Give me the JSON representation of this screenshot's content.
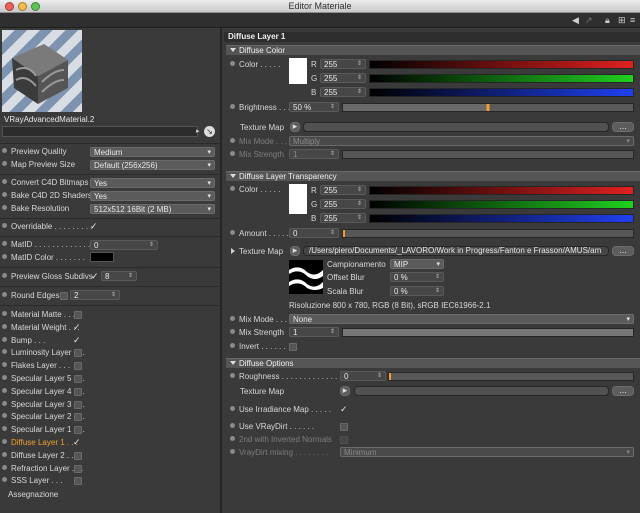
{
  "window": {
    "title": "Editor Materiale"
  },
  "material": {
    "name": "VRayAdvancedMaterial.2"
  },
  "left": {
    "preview_quality": {
      "label": "Preview Quality",
      "value": "Medium"
    },
    "map_preview_size": {
      "label": "Map Preview Size",
      "value": "Default (256x256)"
    },
    "convert_bitmaps": {
      "label": "Convert C4D Bitmaps",
      "value": "Yes"
    },
    "bake_shaders": {
      "label": "Bake C4D 2D Shaders",
      "value": "Yes"
    },
    "bake_resolution": {
      "label": "Bake Resolution",
      "value": "512x512  16Bit  (2 MB)"
    },
    "overridable": {
      "label": "Overridable",
      "check": "✓"
    },
    "matid": {
      "label": "MatID",
      "value": "0"
    },
    "matid_color": {
      "label": "MatID Color"
    },
    "preview_gloss": {
      "label": "Preview Gloss Subdivs",
      "check": "✓",
      "value": "8"
    },
    "round_edges": {
      "label": "Round Edges",
      "value": "2"
    },
    "layers": [
      {
        "label": "Material Matte",
        "check": ""
      },
      {
        "label": "Material Weight",
        "check": "✓"
      },
      {
        "label": "Bump",
        "check": "✓"
      },
      {
        "label": "Luminosity Layer",
        "check": ""
      },
      {
        "label": "Flakes Layer",
        "check": ""
      },
      {
        "label": "Specular Layer 5",
        "check": ""
      },
      {
        "label": "Specular Layer 4",
        "check": ""
      },
      {
        "label": "Specular Layer 3",
        "check": ""
      },
      {
        "label": "Specular Layer 2",
        "check": ""
      },
      {
        "label": "Specular Layer 1",
        "check": ""
      },
      {
        "label": "Diffuse Layer 1",
        "check": "✓",
        "active": true
      },
      {
        "label": "Diffuse Layer 2",
        "check": ""
      },
      {
        "label": "Refraction Layer",
        "check": ""
      },
      {
        "label": "SSS Layer",
        "check": ""
      }
    ],
    "assignment": "Assegnazione"
  },
  "right": {
    "header": "Diffuse Layer 1",
    "diffuse_color": {
      "section": "Diffuse Color",
      "color_label": "Color",
      "r": "255",
      "g": "255",
      "b": "255",
      "brightness_label": "Brightness",
      "brightness": "50 %",
      "texture_map_label": "Texture Map",
      "mix_mode_label": "Mix Mode",
      "mix_mode": "Multiply",
      "mix_strength_label": "Mix Strength",
      "mix_strength": "1"
    },
    "transparency": {
      "section": "Diffuse Layer Transparency",
      "color_label": "Color",
      "r": "255",
      "g": "255",
      "b": "255",
      "amount_label": "Amount",
      "amount": "0",
      "texture_map_label": "Texture Map",
      "texture_path": "/Users/piero/Documents/_LAVORO/Work in Progress/Fanton e Frasson/AMUS/am",
      "sampling_label": "Campionamento",
      "sampling": "MIP",
      "offset_blur_label": "Offset Blur",
      "offset_blur": "0 %",
      "scale_blur_label": "Scala Blur",
      "scale_blur": "0 %",
      "resolution": "Risoluzione 800 x 780, RGB (8 Bit), sRGB IEC61966-2.1",
      "mix_mode_label": "Mix Mode",
      "mix_mode": "None",
      "mix_strength_label": "Mix Strength",
      "mix_strength": "1",
      "invert_label": "Invert"
    },
    "options": {
      "section": "Diffuse Options",
      "roughness_label": "Roughness",
      "roughness": "0",
      "texture_map_label": "Texture Map",
      "irradiance_label": "Use Irradiance Map",
      "irradiance_check": "✓",
      "vraydirt_label": "Use VRayDirt",
      "inverted_normals_label": "2nd with Inverted Normals",
      "vraydirt_mixing_label": "VrayDirt mixing",
      "vraydirt_mixing": "Minimum"
    }
  },
  "colors": {
    "accent": "#f0a030",
    "red": "#e02020",
    "green": "#20d020",
    "blue": "#2040f0"
  }
}
